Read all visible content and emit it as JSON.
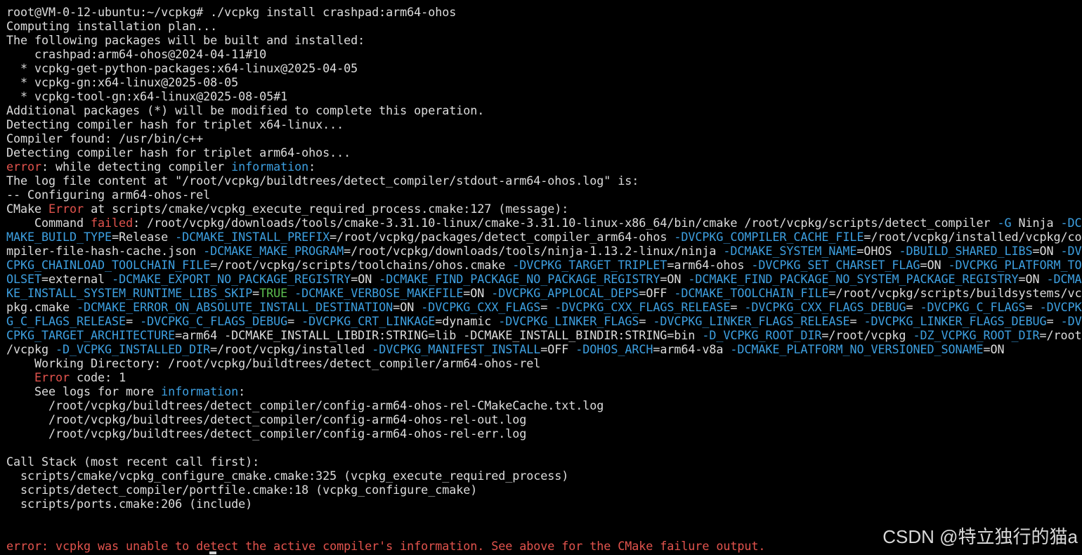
{
  "colors": {
    "background": "#000000",
    "default": "#dcdcdc",
    "red": "#e2534d",
    "blue": "#3d9fe0",
    "green": "#5bbd4f",
    "watermark": "#d8d8d8"
  },
  "terminal": {
    "lines": [
      [
        {
          "t": "root@VM-0-12-ubuntu:~/vcpkg# ./vcpkg install crashpad:arm64-ohos",
          "c": "default"
        }
      ],
      [
        {
          "t": "Computing installation plan...",
          "c": "default"
        }
      ],
      [
        {
          "t": "The following packages will be built and installed:",
          "c": "default"
        }
      ],
      [
        {
          "t": "    crashpad:arm64-ohos@2024-04-11#10",
          "c": "default"
        }
      ],
      [
        {
          "t": "  * vcpkg-get-python-packages:x64-linux@2025-04-05",
          "c": "default"
        }
      ],
      [
        {
          "t": "  * vcpkg-gn:x64-linux@2025-08-05",
          "c": "default"
        }
      ],
      [
        {
          "t": "  * vcpkg-tool-gn:x64-linux@2025-08-05#1",
          "c": "default"
        }
      ],
      [
        {
          "t": "Additional packages (*) will be modified to complete this operation.",
          "c": "default"
        }
      ],
      [
        {
          "t": "Detecting compiler hash for triplet x64-linux...",
          "c": "default"
        }
      ],
      [
        {
          "t": "Compiler found: /usr/bin/c++",
          "c": "default"
        }
      ],
      [
        {
          "t": "Detecting compiler hash for triplet arm64-ohos...",
          "c": "default"
        }
      ],
      [
        {
          "t": "error",
          "c": "red"
        },
        {
          "t": ": while detecting compiler ",
          "c": "default"
        },
        {
          "t": "information",
          "c": "blue"
        },
        {
          "t": ":",
          "c": "default"
        }
      ],
      [
        {
          "t": "The log file content at \"/root/vcpkg/buildtrees/detect_compiler/stdout-arm64-ohos.log\" is:",
          "c": "default"
        }
      ],
      [
        {
          "t": "-- Configuring arm64-ohos-rel",
          "c": "default"
        }
      ],
      [
        {
          "t": "CMake ",
          "c": "default"
        },
        {
          "t": "Error",
          "c": "red"
        },
        {
          "t": " at scripts/cmake/vcpkg_execute_required_process.cmake:127 (message):",
          "c": "default"
        }
      ],
      [
        {
          "t": "    Command ",
          "c": "default"
        },
        {
          "t": "failed",
          "c": "red"
        },
        {
          "t": ": /root/vcpkg/downloads/tools/cmake-3.31.10-linux/cmake-3.31.10-linux-x86_64/bin/cmake /root/vcpkg/scripts/detect_compiler ",
          "c": "default"
        },
        {
          "t": "-G",
          "c": "blue"
        },
        {
          "t": " Ninja ",
          "c": "default"
        },
        {
          "t": "-DC",
          "c": "blue"
        }
      ],
      [
        {
          "t": "MAKE_BUILD_TYPE",
          "c": "blue"
        },
        {
          "t": "=Release ",
          "c": "default"
        },
        {
          "t": "-DCMAKE_INSTALL_PREFIX",
          "c": "blue"
        },
        {
          "t": "=/root/vcpkg/packages/detect_compiler_arm64-ohos ",
          "c": "default"
        },
        {
          "t": "-DVCPKG_COMPILER_CACHE_FILE",
          "c": "blue"
        },
        {
          "t": "=/root/vcpkg/installed/vcpkg/co",
          "c": "default"
        }
      ],
      [
        {
          "t": "mpiler-file-hash-cache.json ",
          "c": "default"
        },
        {
          "t": "-DCMAKE_MAKE_PROGRAM",
          "c": "blue"
        },
        {
          "t": "=/root/vcpkg/downloads/tools/ninja-1.13.2-linux/ninja ",
          "c": "default"
        },
        {
          "t": "-DCMAKE_SYSTEM_NAME",
          "c": "blue"
        },
        {
          "t": "=OHOS ",
          "c": "default"
        },
        {
          "t": "-DBUILD_SHARED_LIBS",
          "c": "blue"
        },
        {
          "t": "=ON ",
          "c": "default"
        },
        {
          "t": "-DV",
          "c": "blue"
        }
      ],
      [
        {
          "t": "CPKG_CHAINLOAD_TOOLCHAIN_FILE",
          "c": "blue"
        },
        {
          "t": "=/root/vcpkg/scripts/toolchains/ohos.cmake ",
          "c": "default"
        },
        {
          "t": "-DVCPKG_TARGET_TRIPLET",
          "c": "blue"
        },
        {
          "t": "=arm64-ohos ",
          "c": "default"
        },
        {
          "t": "-DVCPKG_SET_CHARSET_FLAG",
          "c": "blue"
        },
        {
          "t": "=ON ",
          "c": "default"
        },
        {
          "t": "-DVCPKG_PLATFORM_TO",
          "c": "blue"
        }
      ],
      [
        {
          "t": "OLSET",
          "c": "blue"
        },
        {
          "t": "=external ",
          "c": "default"
        },
        {
          "t": "-DCMAKE_EXPORT_NO_PACKAGE_REGISTRY",
          "c": "blue"
        },
        {
          "t": "=ON ",
          "c": "default"
        },
        {
          "t": "-DCMAKE_FIND_PACKAGE_NO_PACKAGE_REGISTRY",
          "c": "blue"
        },
        {
          "t": "=ON ",
          "c": "default"
        },
        {
          "t": "-DCMAKE_FIND_PACKAGE_NO_SYSTEM_PACKAGE_REGISTRY",
          "c": "blue"
        },
        {
          "t": "=ON ",
          "c": "default"
        },
        {
          "t": "-DCMA",
          "c": "blue"
        }
      ],
      [
        {
          "t": "KE_INSTALL_SYSTEM_RUNTIME_LIBS_SKIP",
          "c": "blue"
        },
        {
          "t": "=",
          "c": "default"
        },
        {
          "t": "TRUE",
          "c": "green"
        },
        {
          "t": " ",
          "c": "default"
        },
        {
          "t": "-DCMAKE_VERBOSE_MAKEFILE",
          "c": "blue"
        },
        {
          "t": "=ON ",
          "c": "default"
        },
        {
          "t": "-DVCPKG_APPLOCAL_DEPS",
          "c": "blue"
        },
        {
          "t": "=OFF ",
          "c": "default"
        },
        {
          "t": "-DCMAKE_TOOLCHAIN_FILE",
          "c": "blue"
        },
        {
          "t": "=/root/vcpkg/scripts/buildsystems/vc",
          "c": "default"
        }
      ],
      [
        {
          "t": "pkg.cmake ",
          "c": "default"
        },
        {
          "t": "-DCMAKE_ERROR_ON_ABSOLUTE_INSTALL_DESTINATION",
          "c": "blue"
        },
        {
          "t": "=ON ",
          "c": "default"
        },
        {
          "t": "-DVCPKG_CXX_FLAGS",
          "c": "blue"
        },
        {
          "t": "= ",
          "c": "default"
        },
        {
          "t": "-DVCPKG_CXX_FLAGS_RELEASE",
          "c": "blue"
        },
        {
          "t": "= ",
          "c": "default"
        },
        {
          "t": "-DVCPKG_CXX_FLAGS_DEBUG",
          "c": "blue"
        },
        {
          "t": "= ",
          "c": "default"
        },
        {
          "t": "-DVCPKG_C_FLAGS",
          "c": "blue"
        },
        {
          "t": "= ",
          "c": "default"
        },
        {
          "t": "-DVCPK",
          "c": "blue"
        }
      ],
      [
        {
          "t": "G_C_FLAGS_RELEASE",
          "c": "blue"
        },
        {
          "t": "= ",
          "c": "default"
        },
        {
          "t": "-DVCPKG_C_FLAGS_DEBUG",
          "c": "blue"
        },
        {
          "t": "= ",
          "c": "default"
        },
        {
          "t": "-DVCPKG_CRT_LINKAGE",
          "c": "blue"
        },
        {
          "t": "=dynamic ",
          "c": "default"
        },
        {
          "t": "-DVCPKG_LINKER_FLAGS",
          "c": "blue"
        },
        {
          "t": "= ",
          "c": "default"
        },
        {
          "t": "-DVCPKG_LINKER_FLAGS_RELEASE",
          "c": "blue"
        },
        {
          "t": "= ",
          "c": "default"
        },
        {
          "t": "-DVCPKG_LINKER_FLAGS_DEBUG",
          "c": "blue"
        },
        {
          "t": "= ",
          "c": "default"
        },
        {
          "t": "-DV",
          "c": "blue"
        }
      ],
      [
        {
          "t": "CPKG_TARGET_ARCHITECTURE",
          "c": "blue"
        },
        {
          "t": "=arm64 -DCMAKE_INSTALL_LIBDIR:STRING=lib -DCMAKE_INSTALL_BINDIR:STRING=bin ",
          "c": "default"
        },
        {
          "t": "-D_VCPKG_ROOT_DIR",
          "c": "blue"
        },
        {
          "t": "=/root/vcpkg ",
          "c": "default"
        },
        {
          "t": "-DZ_VCPKG_ROOT_DIR",
          "c": "blue"
        },
        {
          "t": "=/root",
          "c": "default"
        }
      ],
      [
        {
          "t": "/vcpkg ",
          "c": "default"
        },
        {
          "t": "-D_VCPKG_INSTALLED_DIR",
          "c": "blue"
        },
        {
          "t": "=/root/vcpkg/installed ",
          "c": "default"
        },
        {
          "t": "-DVCPKG_MANIFEST_INSTALL",
          "c": "blue"
        },
        {
          "t": "=OFF ",
          "c": "default"
        },
        {
          "t": "-DOHOS_ARCH",
          "c": "blue"
        },
        {
          "t": "=arm64-v8a ",
          "c": "default"
        },
        {
          "t": "-DCMAKE_PLATFORM_NO_VERSIONED_SONAME",
          "c": "blue"
        },
        {
          "t": "=ON",
          "c": "default"
        }
      ],
      [
        {
          "t": "    Working Directory: /root/vcpkg/buildtrees/detect_compiler/arm64-ohos-rel",
          "c": "default"
        }
      ],
      [
        {
          "t": "    ",
          "c": "default"
        },
        {
          "t": "Error",
          "c": "red"
        },
        {
          "t": " code: 1",
          "c": "default"
        }
      ],
      [
        {
          "t": "    See logs for more ",
          "c": "default"
        },
        {
          "t": "information",
          "c": "blue"
        },
        {
          "t": ":",
          "c": "default"
        }
      ],
      [
        {
          "t": "      /root/vcpkg/buildtrees/detect_compiler/config-arm64-ohos-rel-CMakeCache.txt.log",
          "c": "default"
        }
      ],
      [
        {
          "t": "      /root/vcpkg/buildtrees/detect_compiler/config-arm64-ohos-rel-out.log",
          "c": "default"
        }
      ],
      [
        {
          "t": "      /root/vcpkg/buildtrees/detect_compiler/config-arm64-ohos-rel-err.log",
          "c": "default"
        }
      ],
      [
        {
          "t": "",
          "c": "default"
        }
      ],
      [
        {
          "t": "Call Stack (most recent call first):",
          "c": "default"
        }
      ],
      [
        {
          "t": "  scripts/cmake/vcpkg_configure_cmake.cmake:325 (vcpkg_execute_required_process)",
          "c": "default"
        }
      ],
      [
        {
          "t": "  scripts/detect_compiler/portfile.cmake:18 (vcpkg_configure_cmake)",
          "c": "default"
        }
      ],
      [
        {
          "t": "  scripts/ports.cmake:206 (include)",
          "c": "default"
        }
      ],
      [
        {
          "t": "",
          "c": "default"
        }
      ],
      [
        {
          "t": "",
          "c": "default"
        }
      ],
      [
        {
          "t": "error: vcpkg was unable to detect the active compiler's information. See above for the CMake failure output.",
          "c": "red"
        }
      ]
    ]
  },
  "watermark": {
    "text": "CSDN @特立独行的猫a"
  }
}
